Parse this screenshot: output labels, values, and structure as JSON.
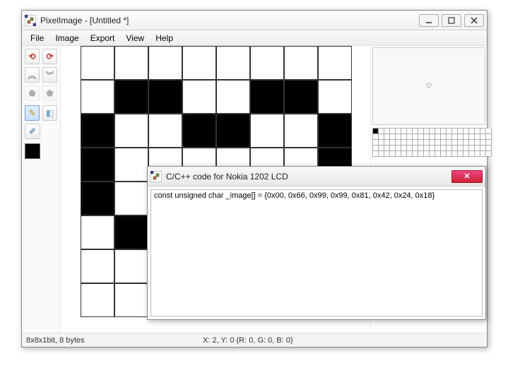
{
  "window": {
    "title": "PixelImage - [Untitled *]"
  },
  "menu": {
    "file": "File",
    "image": "Image",
    "export": "Export",
    "view": "View",
    "help": "Help"
  },
  "status": {
    "doc_info": "8x8x1bit, 8 bytes",
    "cursor_info": "X: 2, Y: 0 (R: 0, G: 0, B: 0)"
  },
  "preview": {
    "glyph": "♡"
  },
  "dialog": {
    "title": "C/C++ code for Nokia 1202 LCD",
    "code": "const unsigned char _image[] = {0x00, 0x66, 0x99, 0x99, 0x81, 0x42, 0x24, 0x18}"
  },
  "pixel_data": {
    "width": 8,
    "height": 8,
    "cells": [
      [
        0,
        0,
        0,
        0,
        0,
        0,
        0,
        0
      ],
      [
        0,
        1,
        1,
        0,
        0,
        1,
        1,
        0
      ],
      [
        1,
        0,
        0,
        1,
        1,
        0,
        0,
        1
      ],
      [
        1,
        0,
        0,
        0,
        0,
        0,
        0,
        1
      ],
      [
        1,
        0,
        0,
        0,
        0,
        0,
        0,
        1
      ],
      [
        0,
        1,
        0,
        0,
        0,
        0,
        1,
        0
      ],
      [
        0,
        0,
        1,
        0,
        0,
        1,
        0,
        0
      ],
      [
        0,
        0,
        0,
        1,
        1,
        0,
        0,
        0
      ]
    ]
  }
}
